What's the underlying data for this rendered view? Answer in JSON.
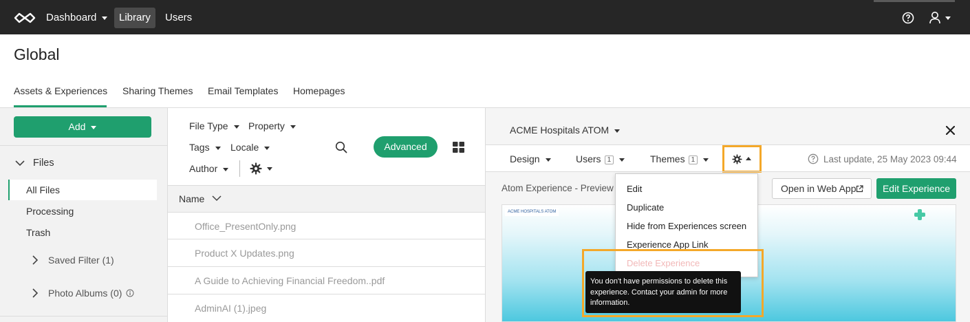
{
  "topbar": {
    "logo_icon": "infinity-logo-icon",
    "nav": [
      {
        "label": "Dashboard"
      },
      {
        "label": "Library"
      },
      {
        "label": "Users"
      }
    ],
    "help_icon": "help-circle-icon",
    "user_icon": "user-icon"
  },
  "page": {
    "title": "Global",
    "tabs": [
      {
        "label": "Assets & Experiences"
      },
      {
        "label": "Sharing Themes"
      },
      {
        "label": "Email Templates"
      },
      {
        "label": "Homepages"
      }
    ]
  },
  "sidebar": {
    "add_label": "Add",
    "files_label": "Files",
    "items": [
      {
        "label": "All Files"
      },
      {
        "label": "Processing"
      },
      {
        "label": "Trash"
      }
    ],
    "saved_filter": "Saved Filter (1)",
    "photo_albums": "Photo Albums (0)"
  },
  "filters": {
    "file_type": "File Type",
    "property": "Property",
    "tags": "Tags",
    "locale": "Locale",
    "author": "Author",
    "advanced": "Advanced"
  },
  "list": {
    "name_header": "Name",
    "files": [
      {
        "name": "Office_PresentOnly.png"
      },
      {
        "name": "Product X Updates.png"
      },
      {
        "name": "A Guide to Achieving Financial Freedom..pdf"
      },
      {
        "name": "AdminAI (1).jpeg"
      }
    ]
  },
  "panel": {
    "experience_name": "ACME Hospitals ATOM",
    "tabs": {
      "design": "Design",
      "users": "Users",
      "users_count": "1",
      "themes": "Themes",
      "themes_count": "1"
    },
    "last_update": "Last update, 25 May 2023 09:44",
    "preview_label": "Atom Experience - Preview C",
    "open_web_app": "Open in Web App",
    "edit_experience": "Edit Experience",
    "preview_logo_text": "ACME HOSPITALS ATOM",
    "menu": [
      {
        "label": "Edit"
      },
      {
        "label": "Duplicate"
      },
      {
        "label": "Hide from Experiences screen"
      },
      {
        "label": "Experience App Link"
      },
      {
        "label": "Delete Experience"
      }
    ],
    "tooltip": "You don't have permissions to delete this experience. Contact your admin for more information.",
    "accent_color": "#1f9f6e",
    "highlight_color": "#f4a829"
  }
}
